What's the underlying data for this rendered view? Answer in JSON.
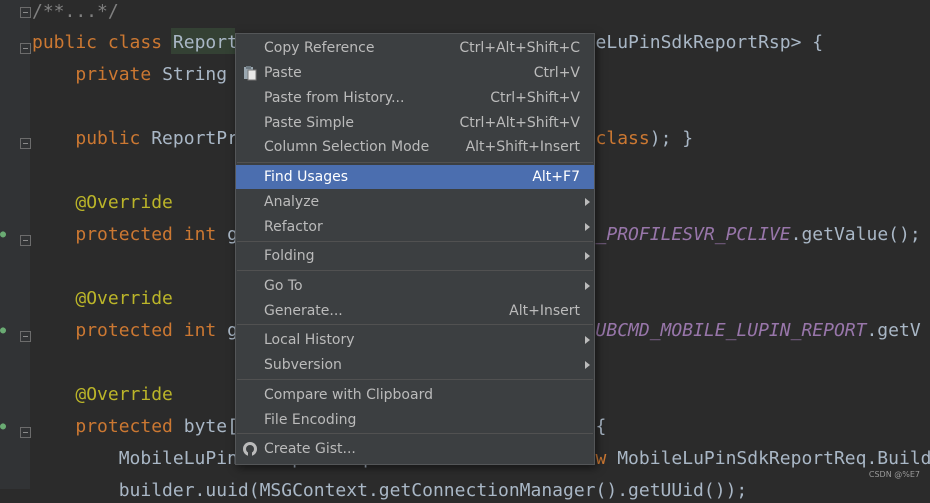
{
  "editor": {
    "lines": [
      {
        "t": [
          {
            "c": "cm",
            "v": "/**...*/"
          }
        ]
      },
      {
        "t": [
          {
            "c": "kw",
            "v": "public class "
          },
          {
            "c": "",
            "v": "Report"
          },
          {
            "c": "",
            "v": "                       "
          },
          {
            "c": "",
            "v": "ata, MobileLuPinSdkReportRsp> {"
          }
        ]
      },
      {
        "t": [
          {
            "c": "",
            "v": "    "
          },
          {
            "c": "kw",
            "v": "private "
          },
          {
            "c": "",
            "v": "String "
          }
        ]
      },
      {
        "t": []
      },
      {
        "t": [
          {
            "c": "",
            "v": "    "
          },
          {
            "c": "kw",
            "v": "public "
          },
          {
            "c": "",
            "v": "ReportPr"
          },
          {
            "c": "",
            "v": "                          "
          },
          {
            "c": "",
            "v": "ortRsp."
          },
          {
            "c": "kw",
            "v": "class"
          },
          {
            "c": "",
            "v": "); }"
          }
        ]
      },
      {
        "t": []
      },
      {
        "t": [
          {
            "c": "",
            "v": "    "
          },
          {
            "c": "ann",
            "v": "@Override"
          }
        ]
      },
      {
        "t": [
          {
            "c": "",
            "v": "    "
          },
          {
            "c": "kw",
            "v": "protected int "
          },
          {
            "c": "",
            "v": "g"
          },
          {
            "c": "",
            "v": "                               "
          },
          {
            "c": "cst",
            "v": "MD_PROFILESVR_PCLIVE"
          },
          {
            "c": "",
            "v": ".getValue();"
          }
        ]
      },
      {
        "t": []
      },
      {
        "t": [
          {
            "c": "",
            "v": "    "
          },
          {
            "c": "ann",
            "v": "@Override"
          }
        ]
      },
      {
        "t": [
          {
            "c": "",
            "v": "    "
          },
          {
            "c": "kw",
            "v": "protected int "
          },
          {
            "c": "",
            "v": "g"
          },
          {
            "c": "",
            "v": "                                "
          },
          {
            "c": "cst",
            "v": "SUBCMD_MOBILE_LUPIN_REPORT"
          },
          {
            "c": "",
            "v": ".getV"
          }
        ]
      },
      {
        "t": []
      },
      {
        "t": [
          {
            "c": "",
            "v": "    "
          },
          {
            "c": "ann",
            "v": "@Override"
          }
        ]
      },
      {
        "t": [
          {
            "c": "",
            "v": "    "
          },
          {
            "c": "kw",
            "v": "protected "
          },
          {
            "c": "",
            "v": "byte[]"
          },
          {
            "c": "",
            "v": "                         "
          },
          {
            "c": "",
            "v": "param) {"
          }
        ]
      },
      {
        "t": [
          {
            "c": "",
            "v": "        MobileLuPinSdkReportReq.Builder builder = "
          },
          {
            "c": "kw",
            "v": "new "
          },
          {
            "c": "",
            "v": "MobileLuPinSdkReportReq.Builde"
          }
        ]
      },
      {
        "t": [
          {
            "c": "",
            "v": "        builder.uuid(MSGContext.getConnectionManager().getUUid());"
          }
        ]
      }
    ]
  },
  "context_menu": {
    "items": [
      {
        "label": "Copy Reference",
        "shortcut": "Ctrl+Alt+Shift+C"
      },
      {
        "label": "Paste",
        "shortcut": "Ctrl+V",
        "icon": "paste-icon"
      },
      {
        "label": "Paste from History...",
        "shortcut": "Ctrl+Shift+V"
      },
      {
        "label": "Paste Simple",
        "shortcut": "Ctrl+Alt+Shift+V"
      },
      {
        "label": "Column Selection Mode",
        "shortcut": "Alt+Shift+Insert"
      },
      {
        "label": "Find Usages",
        "shortcut": "Alt+F7",
        "selected": true
      },
      {
        "label": "Analyze",
        "submenu": true
      },
      {
        "label": "Refactor",
        "submenu": true
      },
      {
        "label": "Folding",
        "submenu": true
      },
      {
        "label": "Go To",
        "submenu": true
      },
      {
        "label": "Generate...",
        "shortcut": "Alt+Insert"
      },
      {
        "label": "Local History",
        "submenu": true
      },
      {
        "label": "Subversion",
        "submenu": true
      },
      {
        "label": "Compare with Clipboard"
      },
      {
        "label": "File Encoding"
      },
      {
        "label": "Create Gist...",
        "icon": "github-icon"
      }
    ]
  },
  "watermark": "CSDN @%E7",
  "colors": {
    "keyword": "#cc7832",
    "annotation": "#bbb529",
    "constant": "#9876aa",
    "selection": "#4b6eaf"
  }
}
